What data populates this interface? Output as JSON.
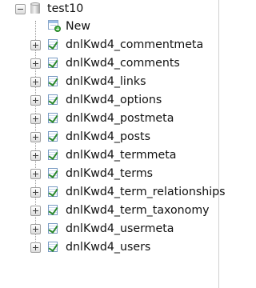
{
  "tree": {
    "database": {
      "name": "test10",
      "icon": "database-icon",
      "expander": "collapse-icon"
    },
    "new_item": {
      "label": "New",
      "icon": "new-table-icon"
    },
    "tables": [
      {
        "label": "dnlKwd4_commentmeta"
      },
      {
        "label": "dnlKwd4_comments"
      },
      {
        "label": "dnlKwd4_links"
      },
      {
        "label": "dnlKwd4_options"
      },
      {
        "label": "dnlKwd4_postmeta"
      },
      {
        "label": "dnlKwd4_posts"
      },
      {
        "label": "dnlKwd4_termmeta"
      },
      {
        "label": "dnlKwd4_terms"
      },
      {
        "label": "dnlKwd4_term_relationships"
      },
      {
        "label": "dnlKwd4_term_taxonomy"
      },
      {
        "label": "dnlKwd4_usermeta"
      },
      {
        "label": "dnlKwd4_users"
      }
    ],
    "table_icon": "table-icon",
    "table_expander": "expand-icon"
  }
}
